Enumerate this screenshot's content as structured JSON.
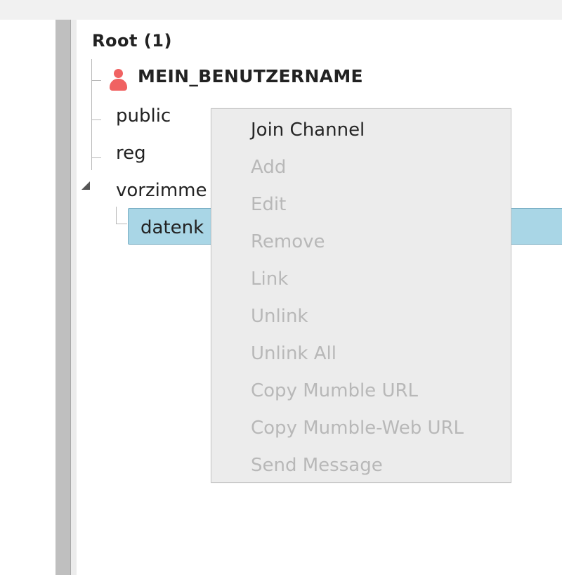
{
  "tree": {
    "root_label": "Root  (1)",
    "user": {
      "name": "MEIN_BENUTZERNAME",
      "icon": "user-icon",
      "icon_color": "#f06262"
    },
    "channels": {
      "public": "public",
      "reg": "reg",
      "vorzimmer": "vorzimme",
      "selected_child": "datenk"
    },
    "selection_color": "#a9d6e6"
  },
  "context_menu": {
    "items": [
      {
        "label": "Join Channel",
        "enabled": true
      },
      {
        "label": "Add",
        "enabled": false
      },
      {
        "label": "Edit",
        "enabled": false
      },
      {
        "label": "Remove",
        "enabled": false
      },
      {
        "label": "Link",
        "enabled": false
      },
      {
        "label": "Unlink",
        "enabled": false
      },
      {
        "label": "Unlink All",
        "enabled": false
      },
      {
        "label": "Copy Mumble URL",
        "enabled": false
      },
      {
        "label": "Copy Mumble-Web URL",
        "enabled": false
      },
      {
        "label": "Send Message",
        "enabled": false
      }
    ]
  }
}
